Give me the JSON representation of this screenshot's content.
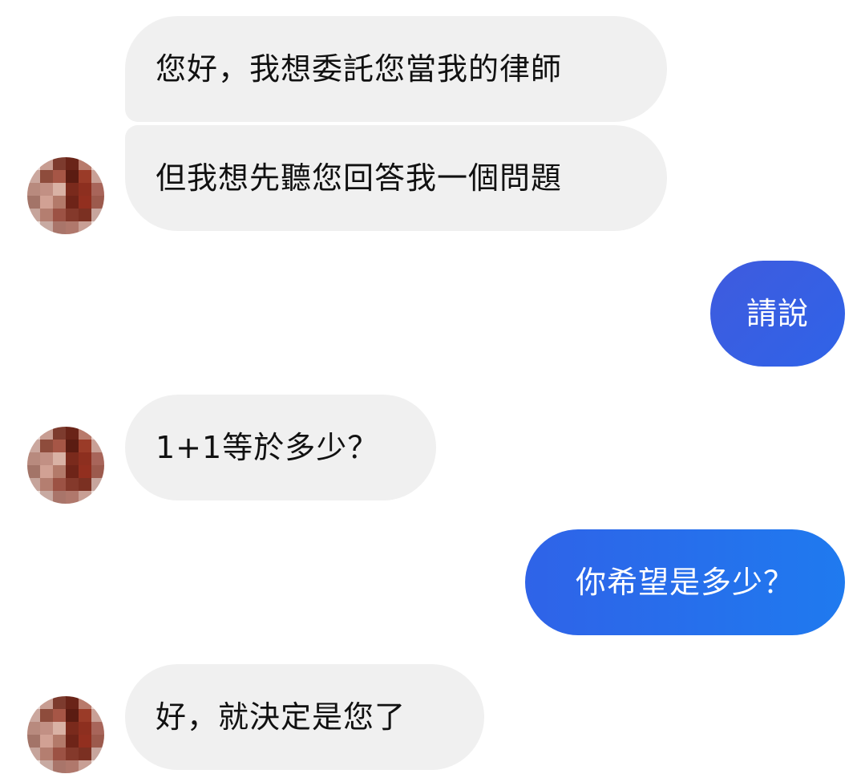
{
  "colors": {
    "incoming_bubble": "#f0f0f0",
    "incoming_text": "#111111",
    "outgoing_gradient": [
      "#3f5bde",
      "#2f63e8",
      "#1f7aef"
    ],
    "outgoing_text": "#ffffff",
    "background": "#ffffff"
  },
  "conversation": {
    "messages": [
      {
        "sender": "other",
        "text": "您好，我想委託您當我的律師"
      },
      {
        "sender": "other",
        "text": "但我想先聽您回答我一個問題"
      },
      {
        "sender": "me",
        "text": "請說"
      },
      {
        "sender": "other",
        "text": "1+1等於多少？"
      },
      {
        "sender": "me",
        "text": "你希望是多少？"
      },
      {
        "sender": "other",
        "text": "好，就決定是您了"
      }
    ],
    "avatar": {
      "icon": "pixelated-avatar-icon"
    }
  }
}
